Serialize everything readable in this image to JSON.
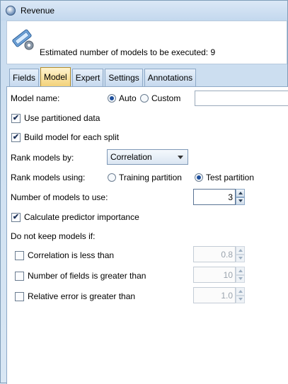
{
  "window": {
    "title": "Revenue"
  },
  "header": {
    "estimate_text": "Estimated number of models to be executed: 9"
  },
  "tabs": [
    {
      "label": "Fields",
      "active": false
    },
    {
      "label": "Model",
      "active": true
    },
    {
      "label": "Expert",
      "active": false
    },
    {
      "label": "Settings",
      "active": false
    },
    {
      "label": "Annotations",
      "active": false
    }
  ],
  "model": {
    "model_name_label": "Model name:",
    "auto_label": "Auto",
    "custom_label": "Custom",
    "model_name_selected": "Auto",
    "model_name_value": "",
    "use_partitioned_label": "Use partitioned data",
    "use_partitioned_checked": true,
    "build_each_split_label": "Build model for each split",
    "build_each_split_checked": true,
    "rank_by_label": "Rank models by:",
    "rank_by_value": "Correlation",
    "rank_using_label": "Rank models using:",
    "training_partition_label": "Training partition",
    "test_partition_label": "Test partition",
    "rank_using_selected": "Test partition",
    "num_models_label": "Number of models to use:",
    "num_models_value": "3",
    "calc_importance_label": "Calculate predictor importance",
    "calc_importance_checked": true,
    "do_not_keep_label": "Do not keep models if:",
    "correlation_less_label": "Correlation is less than",
    "correlation_less_checked": false,
    "correlation_less_value": "0.8",
    "fields_greater_label": "Number of fields is greater than",
    "fields_greater_checked": false,
    "fields_greater_value": "10",
    "rel_error_label": "Relative error is greater than",
    "rel_error_checked": false,
    "rel_error_value": "1.0"
  },
  "icons": {
    "title": "spss-modeler-icon",
    "node": "model-node-icon"
  }
}
